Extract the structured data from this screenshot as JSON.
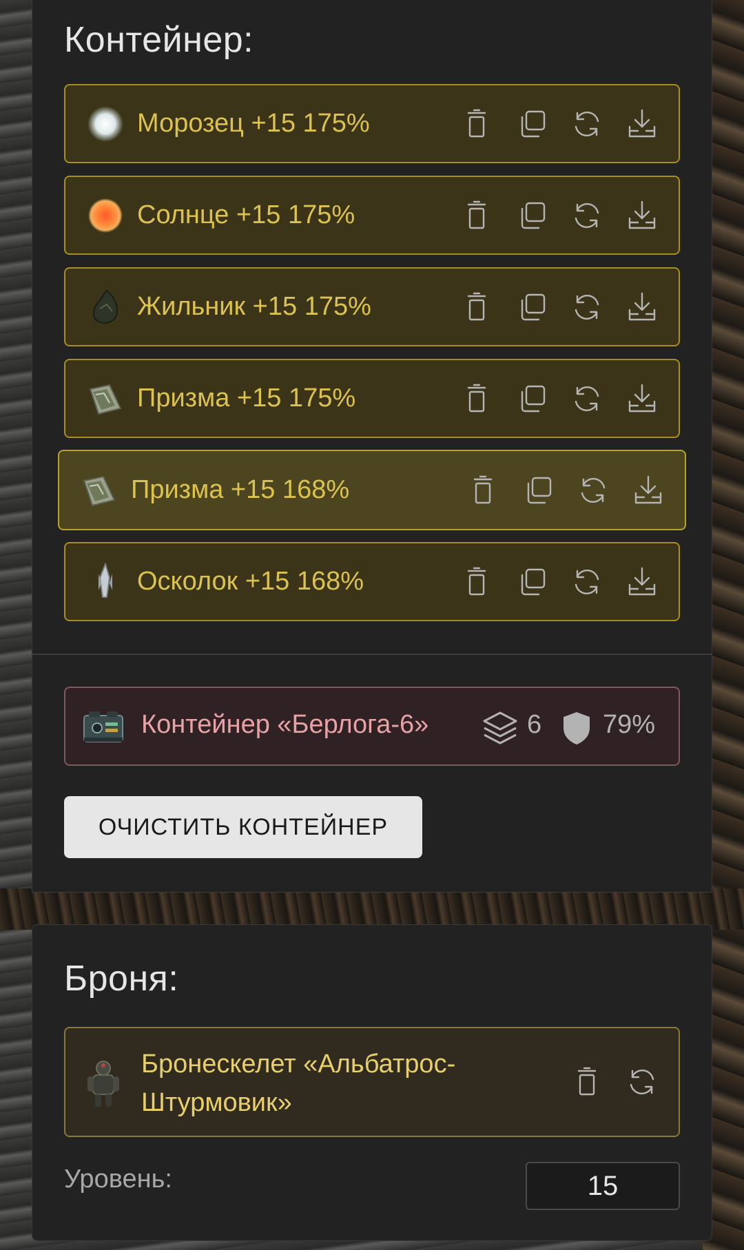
{
  "container_section": {
    "title": "Контейнер:",
    "artifacts": [
      {
        "label": "Морозец +15 175%",
        "icon": "frost-orb-icon"
      },
      {
        "label": "Солнце +15 175%",
        "icon": "sun-orb-icon"
      },
      {
        "label": "Жильник +15 175%",
        "icon": "vein-stone-icon"
      },
      {
        "label": "Призма +15 175%",
        "icon": "prism-icon"
      },
      {
        "label": "Призма +15 168%",
        "icon": "prism-icon",
        "selected": true
      },
      {
        "label": "Осколок +15 168%",
        "icon": "shard-crystal-icon"
      }
    ],
    "artifact_actions": [
      "trash-icon",
      "copy-icon",
      "refresh-icon",
      "download-icon"
    ],
    "container": {
      "label": "Контейнер «Берлога-6»",
      "capacity": "6",
      "protection": "79%"
    },
    "clear_button": "ОЧИСТИТЬ КОНТЕЙНЕР"
  },
  "armor_section": {
    "title": "Броня:",
    "armor": {
      "label": "Бронескелет «Альбатрос-Штурмовик»",
      "icon": "exoskeleton-icon"
    },
    "level_label": "Уровень:",
    "level_value": "15"
  },
  "colors": {
    "artifact_text": "#dcc24e",
    "container_text": "#e8a2a6",
    "panel_bg": "#222223"
  }
}
